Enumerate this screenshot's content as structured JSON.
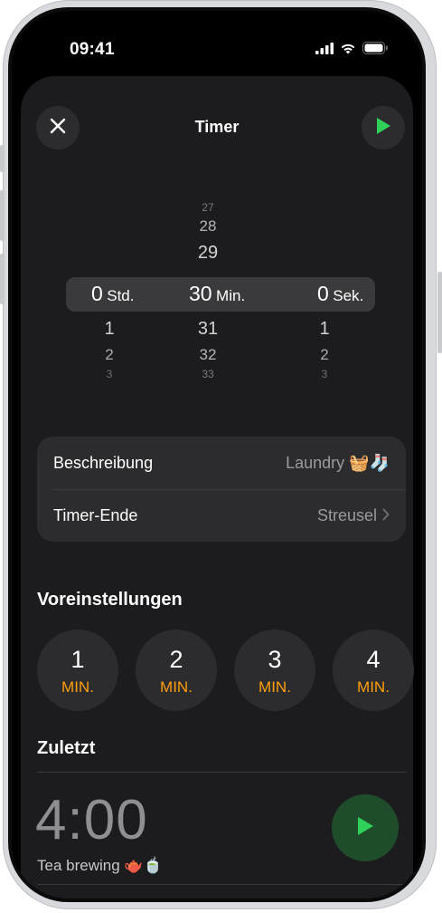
{
  "status": {
    "time": "09:41"
  },
  "header": {
    "title": "Timer"
  },
  "picker": {
    "hours": {
      "above": [
        "",
        "",
        ""
      ],
      "selected": "0",
      "unit": "Std.",
      "below": [
        "1",
        "2",
        "3"
      ]
    },
    "minutes": {
      "above": [
        "27",
        "28",
        "29"
      ],
      "selected": "30",
      "unit": "Min.",
      "below": [
        "31",
        "32",
        "33"
      ]
    },
    "seconds": {
      "above": [
        "",
        "",
        ""
      ],
      "selected": "0",
      "unit": "Sek.",
      "below": [
        "1",
        "2",
        "3"
      ]
    }
  },
  "settings": {
    "description_label": "Beschreibung",
    "description_value": "Laundry 🧺🧦",
    "end_label": "Timer-Ende",
    "end_value": "Streusel"
  },
  "presets": {
    "heading": "Voreinstellungen",
    "items": [
      {
        "value": "1",
        "unit": "MIN."
      },
      {
        "value": "2",
        "unit": "MIN."
      },
      {
        "value": "3",
        "unit": "MIN."
      },
      {
        "value": "4",
        "unit": "MIN."
      }
    ]
  },
  "recent": {
    "heading": "Zuletzt",
    "time": "4:00",
    "label": "Tea brewing 🫖🍵"
  },
  "colors": {
    "accent_green": "#30d158",
    "accent_orange": "#ff9f0a",
    "sheet_bg": "#1c1c1e"
  },
  "icons": [
    "close-icon",
    "play-icon",
    "chevron-right-icon",
    "signal-icon",
    "wifi-icon",
    "battery-icon"
  ]
}
